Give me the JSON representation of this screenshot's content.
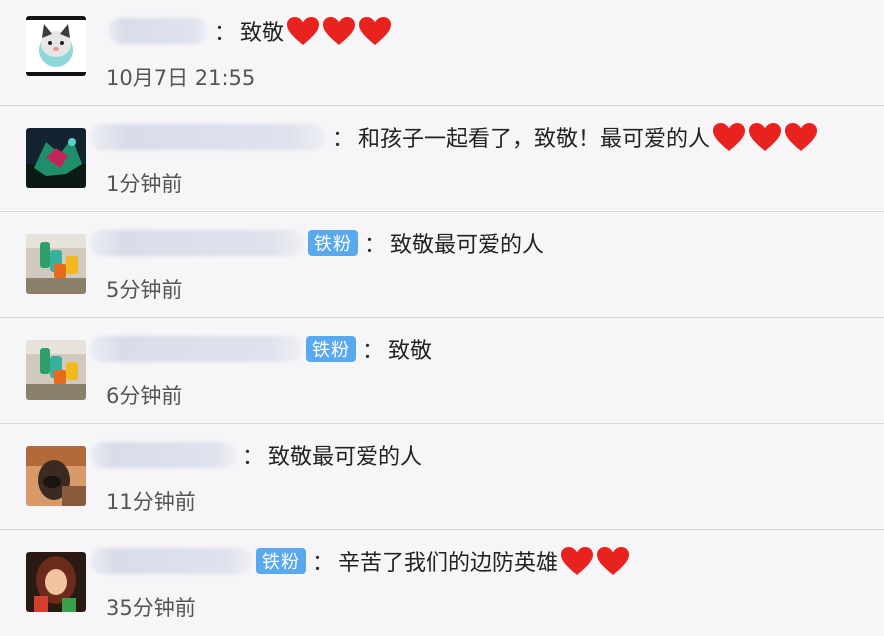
{
  "comments": [
    {
      "text": "致敬",
      "time": "10月7日 21:55",
      "fan_badge": "",
      "hearts": 3,
      "name_width": 100
    },
    {
      "text": "和孩子一起看了，致敬！最可爱的人",
      "time": "1分钟前",
      "fan_badge": "",
      "hearts": 3,
      "name_width": 236
    },
    {
      "text": "致敬最可爱的人",
      "time": "5分钟前",
      "fan_badge": "铁粉",
      "hearts": 0,
      "name_width": 214
    },
    {
      "text": "致敬",
      "time": "6分钟前",
      "fan_badge": "铁粉",
      "hearts": 0,
      "name_width": 212
    },
    {
      "text": "致敬最可爱的人",
      "time": "11分钟前",
      "fan_badge": "",
      "hearts": 0,
      "name_width": 146
    },
    {
      "text": "辛苦了我们的边防英雄",
      "time": "35分钟前",
      "fan_badge": "铁粉",
      "hearts": 2,
      "name_width": 162
    }
  ],
  "colors": {
    "background": "#f6f5f8",
    "badge": "#5aa9ee",
    "heart": "#e8231f"
  },
  "icons": {
    "heart": "red-heart-emoji"
  }
}
